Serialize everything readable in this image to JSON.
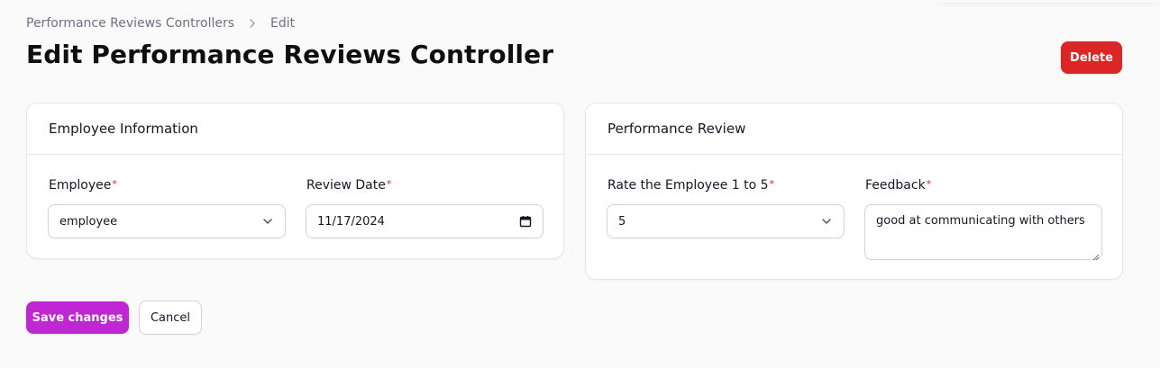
{
  "breadcrumb": {
    "parent": "Performance Reviews Controllers",
    "current": "Edit"
  },
  "page": {
    "title": "Edit Performance Reviews Controller",
    "delete_label": "Delete"
  },
  "employee_card": {
    "heading": "Employee Information",
    "employee": {
      "label": "Employee",
      "required": "*",
      "value": "employee"
    },
    "review_date": {
      "label": "Review Date",
      "required": "*",
      "value": "11/17/2024"
    }
  },
  "review_card": {
    "heading": "Performance Review",
    "rating": {
      "label": "Rate the Employee 1 to 5",
      "required": "*",
      "value": "5"
    },
    "feedback": {
      "label": "Feedback",
      "required": "*",
      "value": "good at communicating with others"
    }
  },
  "actions": {
    "save_label": "Save changes",
    "cancel_label": "Cancel"
  },
  "colors": {
    "primary": "#c026d3",
    "danger": "#dc2626",
    "required": "#dc2626"
  },
  "icons": {
    "breadcrumb_separator": "chevron-right-icon",
    "select_arrow": "chevron-down-icon",
    "date_picker": "calendar-icon"
  }
}
